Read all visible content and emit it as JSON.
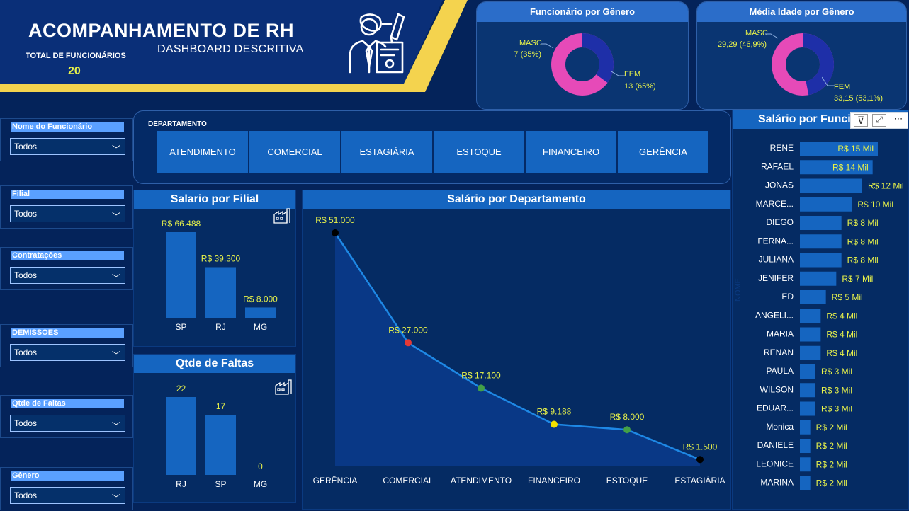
{
  "header": {
    "title": "ACOMPANHAMENTO DE RH",
    "subtitle": "DASHBOARD DESCRITIVA",
    "total_label": "TOTAL DE FUNCIONÁRIOS",
    "total_value": "20",
    "icon": "employee-document-icon"
  },
  "gender_card": {
    "title": "Funcionário por Gênero",
    "masc_label": "MASC",
    "masc_value": "7 (35%)",
    "fem_label": "FEM",
    "fem_value": "13 (65%)"
  },
  "age_card": {
    "title": "Média Idade por Gênero",
    "masc_label": "MASC",
    "masc_value": "29,29 (46,9%)",
    "fem_label": "FEM",
    "fem_value": "33,15 (53,1%)"
  },
  "slicers": [
    {
      "label": "Nome do Funcionário",
      "value": "Todos"
    },
    {
      "label": "Filial",
      "value": "Todos"
    },
    {
      "label": "Contratações",
      "value": "Todos"
    },
    {
      "label": "DEMISSOES",
      "value": "Todos"
    },
    {
      "label": "Qtde de Faltas",
      "value": "Todos"
    },
    {
      "label": "Gênero",
      "value": "Todos"
    }
  ],
  "departamento": {
    "title": "DEPARTAMENTO",
    "buttons": [
      "ATENDIMENTO",
      "COMERCIAL",
      "ESTAGIÁRIA",
      "ESTOQUE",
      "FINANCEIRO",
      "GERÊNCIA"
    ]
  },
  "salario_filial": {
    "title": "Salario por Filial",
    "icon": "factory-icon"
  },
  "faltas": {
    "title": "Qtde de Faltas",
    "icon": "factory-icon"
  },
  "salario_depto": {
    "title": "Salário por Departamento"
  },
  "salario_func": {
    "title": "Salário por Funcionário",
    "ylabel": "NOME",
    "icons": [
      "filter-icon",
      "expand-icon",
      "more-icon"
    ]
  },
  "colors": {
    "background": "#04235a",
    "accent_blue": "#1565c0",
    "yellow_label": "#e8f24a",
    "pink": "#e64ab8",
    "dark_blue_donut": "#1e2fa8",
    "stripe_yellow": "#f4d34e"
  },
  "chart_data": [
    {
      "type": "pie",
      "title": "Funcionário por Gênero",
      "categories": [
        "MASC",
        "FEM"
      ],
      "values": [
        7,
        13
      ],
      "labels": [
        "7 (35%)",
        "13 (65%)"
      ]
    },
    {
      "type": "pie",
      "title": "Média Idade por Gênero",
      "categories": [
        "MASC",
        "FEM"
      ],
      "values": [
        29.29,
        33.15
      ],
      "labels": [
        "29,29 (46,9%)",
        "33,15 (53,1%)"
      ]
    },
    {
      "type": "bar",
      "title": "Salario por Filial",
      "categories": [
        "SP",
        "RJ",
        "MG"
      ],
      "values": [
        66488,
        39300,
        8000
      ],
      "labels": [
        "R$ 66.488",
        "R$ 39.300",
        "R$ 8.000"
      ]
    },
    {
      "type": "bar",
      "title": "Qtde de Faltas",
      "categories": [
        "RJ",
        "SP",
        "MG"
      ],
      "values": [
        22,
        17,
        0
      ],
      "labels": [
        "22",
        "17",
        "0"
      ]
    },
    {
      "type": "area",
      "title": "Salário por Departamento",
      "categories": [
        "GERÊNCIA",
        "COMERCIAL",
        "ATENDIMENTO",
        "FINANCEIRO",
        "ESTOQUE",
        "ESTAGIÁRIA"
      ],
      "values": [
        51000,
        27000,
        17100,
        9188,
        8000,
        1500
      ],
      "labels": [
        "R$ 51.000",
        "R$ 27.000",
        "R$ 17.100",
        "R$ 9.188",
        "R$ 8.000",
        "R$ 1.500"
      ],
      "point_colors": [
        "#000000",
        "#e53935",
        "#43a047",
        "#f4e100",
        "#43a047",
        "#000000"
      ]
    },
    {
      "type": "bar",
      "orientation": "horizontal",
      "title": "Salário por Funcionário",
      "ylabel": "NOME",
      "categories": [
        "RENE",
        "RAFAEL",
        "JONAS",
        "MARCE...",
        "DIEGO",
        "FERNA...",
        "JULIANA",
        "JENIFER",
        "ED",
        "ANGELI...",
        "MARIA",
        "RENAN",
        "PAULA",
        "WILSON",
        "EDUAR...",
        "Monica",
        "DANIELE",
        "LEONICE",
        "MARINA"
      ],
      "values": [
        15,
        14,
        12,
        10,
        8,
        8,
        8,
        7,
        5,
        4,
        4,
        4,
        3,
        3,
        3,
        2,
        2,
        2,
        2
      ],
      "labels": [
        "R$ 15 Mil",
        "R$ 14 Mil",
        "R$ 12 Mil",
        "R$ 10 Mil",
        "R$ 8 Mil",
        "R$ 8 Mil",
        "R$ 8 Mil",
        "R$ 7 Mil",
        "R$ 5 Mil",
        "R$ 4 Mil",
        "R$ 4 Mil",
        "R$ 4 Mil",
        "R$ 3 Mil",
        "R$ 3 Mil",
        "R$ 3 Mil",
        "R$ 2 Mil",
        "R$ 2 Mil",
        "R$ 2 Mil",
        "R$ 2 Mil"
      ]
    }
  ]
}
